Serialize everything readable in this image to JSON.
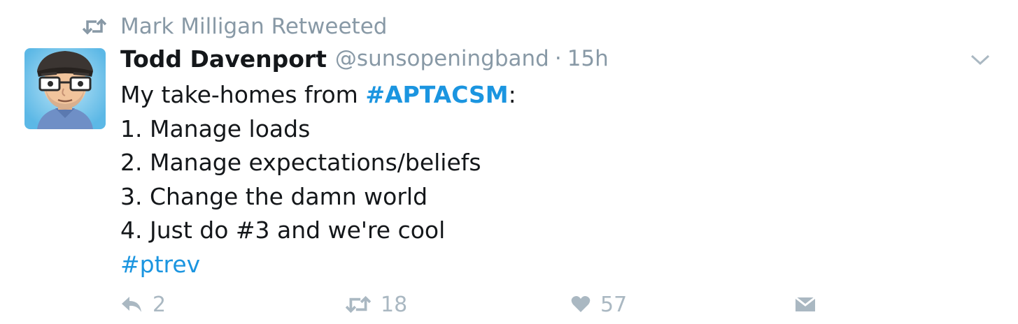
{
  "retweet_context": {
    "icon": "retweet-icon",
    "text": "Mark Milligan Retweeted"
  },
  "tweet": {
    "author_name": "Todd Davenport",
    "author_handle": "@sunsopeningband",
    "separator": "·",
    "timestamp": "15h",
    "body": {
      "intro_prefix": "My take-homes from ",
      "intro_hashtag": "#APTACSM",
      "intro_suffix": ":",
      "line1": "1. Manage loads",
      "line2": "2. Manage expectations/beliefs",
      "line3": "3. Change the damn world",
      "line4": "4. Just do #3 and we're cool",
      "trailing_hashtag": "#ptrev"
    }
  },
  "actions": {
    "reply_count": "2",
    "retweet_count": "18",
    "like_count": "57"
  },
  "colors": {
    "link": "#1b95e0",
    "muted": "#8899a6",
    "action": "#aab8c2",
    "text": "#14171a"
  }
}
